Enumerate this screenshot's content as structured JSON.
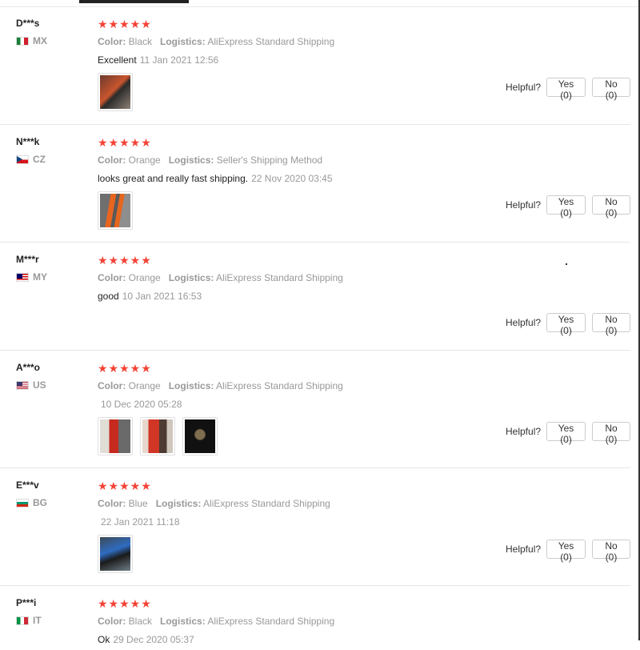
{
  "helpful_label": "Helpful?",
  "reviews": [
    {
      "user": "D***s",
      "country": "MX",
      "stars": "★★★★★",
      "color_label": "Color:",
      "color": "Black",
      "logistics_label": "Logistics:",
      "logistics": "AliExpress Standard Shipping",
      "text": "Excellent",
      "date": "11 Jan 2021 12:56",
      "yes": "Yes (0)",
      "no": "No (0)"
    },
    {
      "user": "N***k",
      "country": "CZ",
      "stars": "★★★★★",
      "color_label": "Color:",
      "color": "Orange",
      "logistics_label": "Logistics:",
      "logistics": "Seller's Shipping Method",
      "text": "looks great and really fast shipping.",
      "date": "22 Nov 2020 03:45",
      "yes": "Yes (0)",
      "no": "No (0)"
    },
    {
      "user": "M***r",
      "country": "MY",
      "stars": "★★★★★",
      "color_label": "Color:",
      "color": "Orange",
      "logistics_label": "Logistics:",
      "logistics": "AliExpress Standard Shipping",
      "text": "good",
      "date": "10 Jan 2021 16:53",
      "yes": "Yes (0)",
      "no": "No (0)"
    },
    {
      "user": "A***o",
      "country": "US",
      "stars": "★★★★★",
      "color_label": "Color:",
      "color": "Orange",
      "logistics_label": "Logistics:",
      "logistics": "AliExpress Standard Shipping",
      "text": "",
      "date": "10 Dec 2020 05:28",
      "yes": "Yes (0)",
      "no": "No (0)"
    },
    {
      "user": "E***v",
      "country": "BG",
      "stars": "★★★★★",
      "color_label": "Color:",
      "color": "Blue",
      "logistics_label": "Logistics:",
      "logistics": "AliExpress Standard Shipping",
      "text": "",
      "date": "22 Jan 2021 11:18",
      "yes": "Yes (0)",
      "no": "No (0)"
    },
    {
      "user": "P***i",
      "country": "IT",
      "stars": "★★★★★",
      "color_label": "Color:",
      "color": "Black",
      "logistics_label": "Logistics:",
      "logistics": "AliExpress Standard Shipping",
      "text": "Ok",
      "date": "29 Dec 2020 05:37",
      "yes": "Yes (0)",
      "no": "No (0)"
    }
  ],
  "icons": {
    "star": "star-icon",
    "flag": "country-flag-icon"
  },
  "colors": {
    "star": "#f44336",
    "muted": "#999999",
    "border": "#e6e6e6"
  }
}
